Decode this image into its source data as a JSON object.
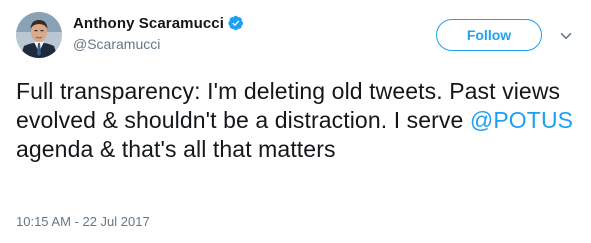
{
  "author": {
    "display_name": "Anthony Scaramucci",
    "handle": "@Scaramucci",
    "verified": true
  },
  "follow_button": {
    "label": "Follow"
  },
  "tweet": {
    "text_before": "Full transparency: I'm deleting old tweets. Past views evolved & shouldn't be a distraction. I serve ",
    "mention": "@POTUS",
    "text_after": " agenda & that's all that matters"
  },
  "timestamp": "10:15 AM - 22 Jul 2017",
  "icons": {
    "verified": "verified-badge-icon",
    "menu": "chevron-down-icon",
    "avatar": "profile-photo"
  },
  "colors": {
    "accent": "#1da1f2",
    "text": "#14171a",
    "secondary": "#657786"
  }
}
